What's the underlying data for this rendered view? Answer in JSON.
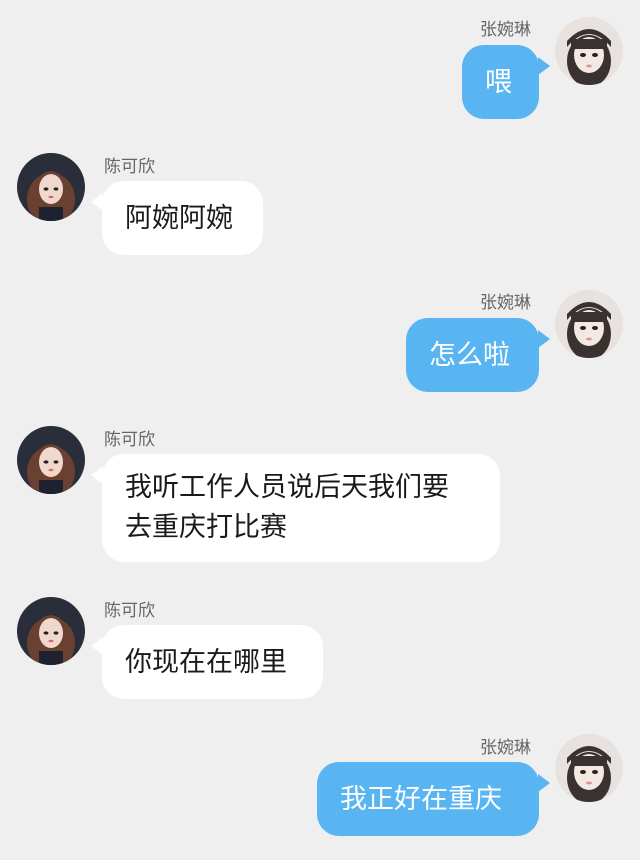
{
  "chat": {
    "background": "#efefef",
    "outgoing_color": "#59b4f2",
    "incoming_color": "#ffffff",
    "messages": [
      {
        "sender": "张婉琳",
        "direction": "outgoing",
        "text": "喂",
        "avatar": "avatar-zhang"
      },
      {
        "sender": "陈可欣",
        "direction": "incoming",
        "text": "阿婉阿婉",
        "avatar": "avatar-chen"
      },
      {
        "sender": "张婉琳",
        "direction": "outgoing",
        "text": "怎么啦",
        "avatar": "avatar-zhang"
      },
      {
        "sender": "陈可欣",
        "direction": "incoming",
        "lines": [
          "我听工作人员说后天我们要",
          "去重庆打比赛"
        ],
        "avatar": "avatar-chen"
      },
      {
        "sender": "陈可欣",
        "direction": "incoming",
        "text": "你现在在哪里",
        "avatar": "avatar-chen"
      },
      {
        "sender": "张婉琳",
        "direction": "outgoing",
        "text": "我正好在重庆",
        "avatar": "avatar-zhang"
      }
    ]
  }
}
